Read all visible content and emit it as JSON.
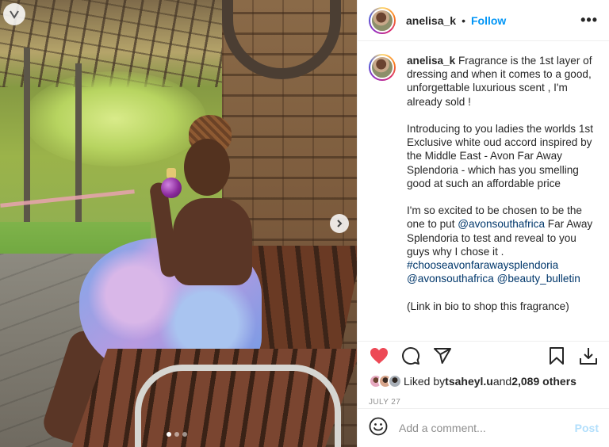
{
  "post": {
    "username": "anelisa_k",
    "separator": "•",
    "follow_label": "Follow",
    "more_label": "•••",
    "caption_username": "anelisa_k",
    "caption_paragraphs": [
      " Fragrance is the 1st layer of dressing and when it comes to a good, unforgettable luxurious scent , I'm already sold !",
      "Introducing to you ladies the worlds 1st Exclusive white oud accord inspired by the Middle East - Avon Far Away Splendoria - which has you smelling good at such an affordable price"
    ],
    "caption_p3_before": "I'm so excited to be chosen to be the one to put ",
    "caption_p3_mention1": "@avonsouthafrica",
    "caption_p3_after": " Far Away Splendoria to test and reveal to you guys why I chose it .",
    "caption_hashtag": "#chooseavonfarawaysplendoria",
    "caption_mention2": "@avonsouthafrica",
    "caption_mention3": "@beauty_bulletin",
    "caption_p4": "(Link in bio to shop this fragrance)"
  },
  "likes": {
    "prefix": "Liked by ",
    "user": "tsaheyl.u",
    "middle": " and ",
    "count": "2,089 others"
  },
  "date": "JULY 27",
  "comment": {
    "placeholder": "Add a comment...",
    "post_label": "Post"
  },
  "carousel": {
    "current_slide": 1,
    "total_slides": 3
  },
  "colors": {
    "accent": "#0095f6",
    "like_red": "#ed4956",
    "post_disabled": "#b2dffc",
    "link": "#00376b"
  },
  "icons": [
    "heart-icon",
    "comment-icon",
    "share-icon",
    "bookmark-icon",
    "download-icon",
    "emoji-icon",
    "chevron-right-icon",
    "slideshow-icon"
  ]
}
